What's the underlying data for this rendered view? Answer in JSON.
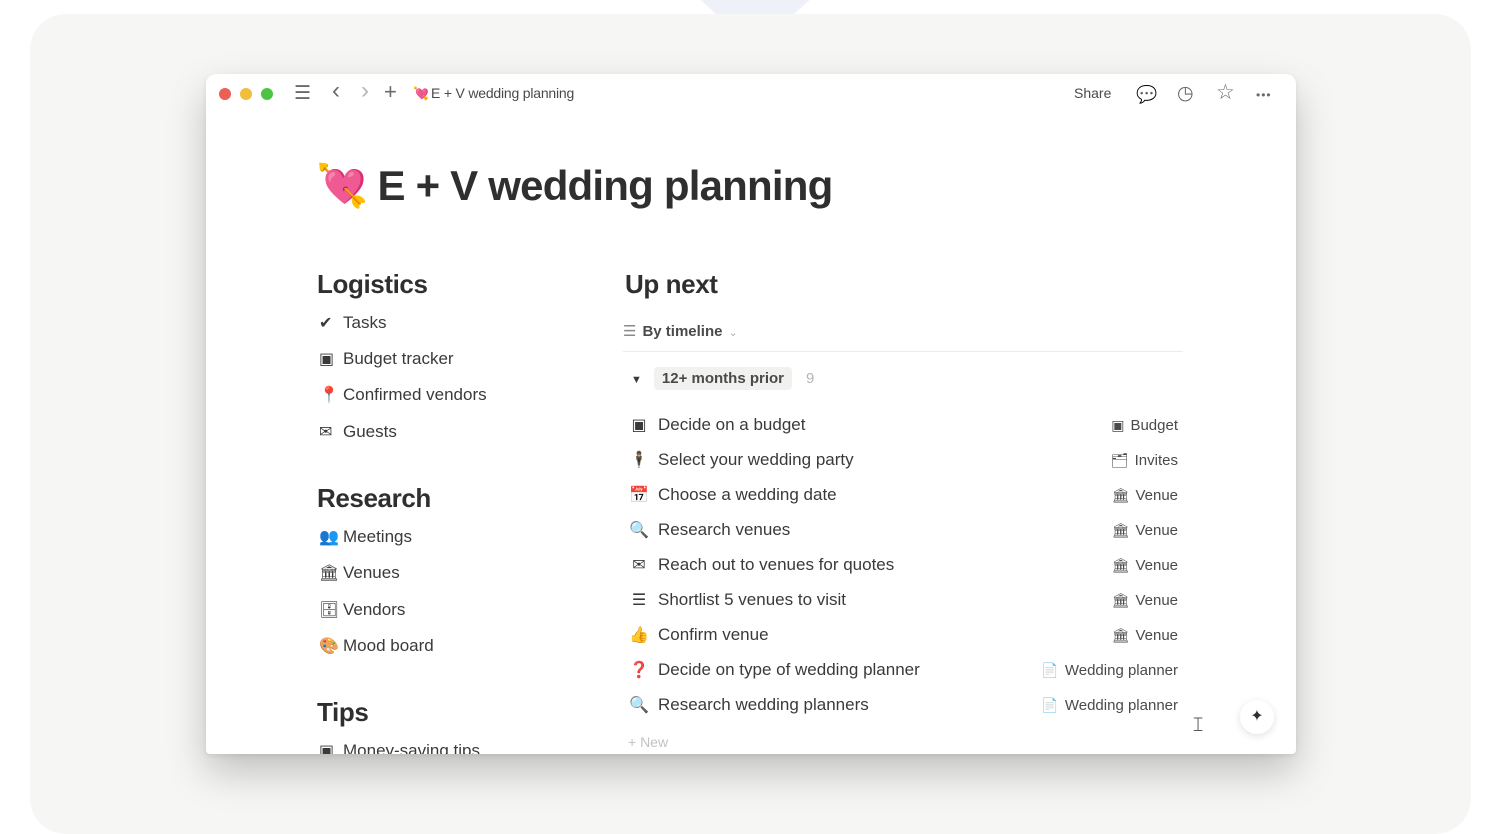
{
  "window": {
    "breadcrumb_emoji": "💘",
    "breadcrumb": "E + V wedding planning",
    "share_label": "Share"
  },
  "icons": {
    "menu": "☰",
    "back": "‹",
    "forward": "›",
    "add": "+",
    "comments": "💬",
    "updates": "◷",
    "favorite": "☆",
    "more": "•••"
  },
  "page": {
    "emoji": "💘",
    "title": "E + V wedding planning"
  },
  "logistics": {
    "heading": "Logistics",
    "items": [
      {
        "icon": "✔",
        "label": "Tasks"
      },
      {
        "icon": "▣",
        "label": "Budget tracker"
      },
      {
        "icon": "📍",
        "label": "Confirmed vendors"
      },
      {
        "icon": "✉",
        "label": "Guests"
      }
    ]
  },
  "research": {
    "heading": "Research",
    "items": [
      {
        "icon": "👥",
        "label": "Meetings"
      },
      {
        "icon": "🏛",
        "label": "Venues"
      },
      {
        "icon": "🗄",
        "label": "Vendors"
      },
      {
        "icon": "🎨",
        "label": "Mood board"
      }
    ]
  },
  "tips": {
    "heading": "Tips",
    "items": [
      {
        "icon": "▣",
        "label": "Money-saving tips"
      }
    ]
  },
  "upnext": {
    "heading": "Up next",
    "view_icon": "☰",
    "view_label": "By timeline",
    "group_label": "12+ months prior",
    "group_count": "9",
    "rows": [
      {
        "icon": "▣",
        "label": "Decide on a budget",
        "tag_icon": "▣",
        "tag": "Budget"
      },
      {
        "icon": "🕴",
        "label": "Select your wedding party",
        "tag_icon": "🗂",
        "tag": "Invites"
      },
      {
        "icon": "📅",
        "label": "Choose a wedding date",
        "tag_icon": "🏛",
        "tag": "Venue"
      },
      {
        "icon": "🔍",
        "label": "Research venues",
        "tag_icon": "🏛",
        "tag": "Venue"
      },
      {
        "icon": "✉",
        "label": "Reach out to venues for quotes",
        "tag_icon": "🏛",
        "tag": "Venue"
      },
      {
        "icon": "☰",
        "label": "Shortlist 5 venues to visit",
        "tag_icon": "🏛",
        "tag": "Venue"
      },
      {
        "icon": "👍",
        "label": "Confirm venue",
        "tag_icon": "🏛",
        "tag": "Venue"
      },
      {
        "icon": "❓",
        "label": "Decide on type of wedding planner",
        "tag_icon": "📄",
        "tag": "Wedding planner"
      },
      {
        "icon": "🔍",
        "label": "Research wedding planners",
        "tag_icon": "📄",
        "tag": "Wedding planner"
      }
    ],
    "new_label": "+ New"
  },
  "colors": {
    "backdrop": "#f6f6f4",
    "traffic_red": "#ec5f57",
    "traffic_yellow": "#f2bd3c",
    "traffic_green": "#4fc443"
  }
}
